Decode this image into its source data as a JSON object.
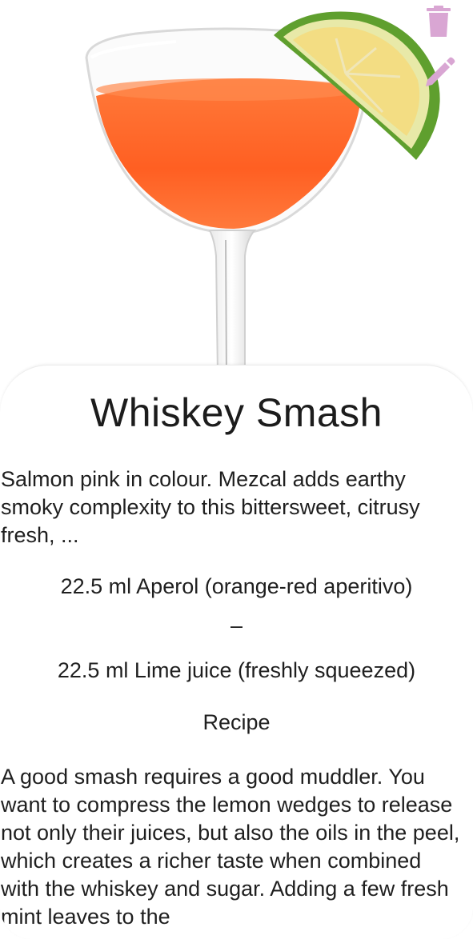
{
  "drink": {
    "image_alt": "Cocktail glass with orange drink and lime wedge",
    "name": "Whiskey Smash",
    "description": "Salmon pink in colour. Mezcal adds earthy smoky complexity to this bittersweet, citrusy fresh, ...",
    "ingredients": [
      "22.5 ml Aperol (orange-red aperitivo)",
      "–",
      "22.5 ml Lime juice (freshly squeezed)"
    ],
    "recipe_heading": "Recipe",
    "recipe_text": "A good smash requires a good muddler. You want to compress the lemon wedges to release not only their juices, but also the oils in the peel, which creates a richer taste when combined with the whiskey and sugar. Adding a few fresh mint leaves to the"
  },
  "actions": {
    "delete_icon": "trash-icon",
    "edit_icon": "pencil-icon",
    "icon_color": "#d9a6d3"
  },
  "colors": {
    "drink": "#ff6a2b",
    "lime_peel": "#6fae3a",
    "lime_flesh": "#f2e28a"
  }
}
